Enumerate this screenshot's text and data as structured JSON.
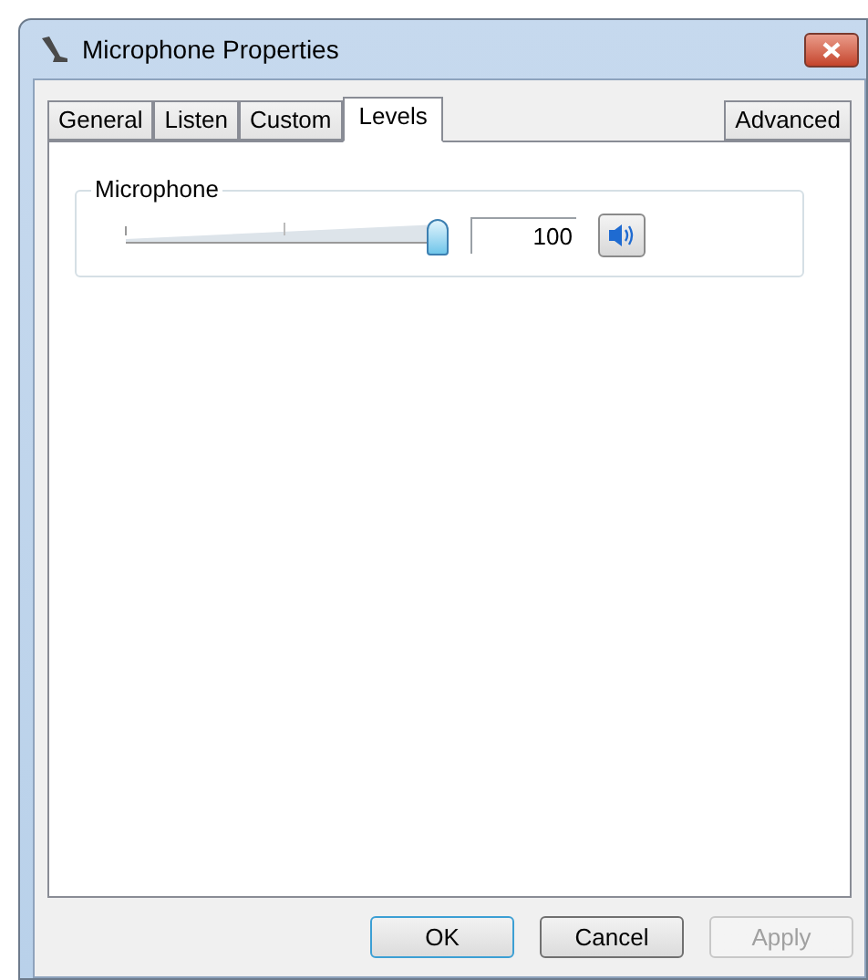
{
  "window": {
    "title": "Microphone Properties"
  },
  "tabs": [
    {
      "label": "General",
      "selected": false
    },
    {
      "label": "Listen",
      "selected": false
    },
    {
      "label": "Custom",
      "selected": false
    },
    {
      "label": "Levels",
      "selected": true
    }
  ],
  "tabs_right": [
    {
      "label": "Advanced",
      "selected": false
    }
  ],
  "group": {
    "label": "Microphone",
    "level": 1,
    "value": "100",
    "muted": false
  },
  "buttons": [
    {
      "label": "OK",
      "default": true,
      "disabled": false
    },
    {
      "label": "Cancel",
      "default": false,
      "disabled": false
    },
    {
      "label": "Apply",
      "default": false,
      "disabled": true
    }
  ]
}
